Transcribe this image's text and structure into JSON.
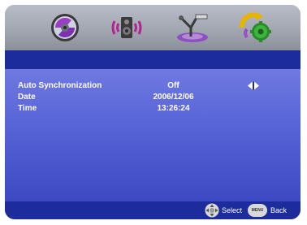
{
  "menu_icons": [
    {
      "name": "disc-setup-icon",
      "selected": false
    },
    {
      "name": "speaker-audio-icon",
      "selected": false
    },
    {
      "name": "satellite-dish-icon",
      "selected": false
    },
    {
      "name": "clock-settings-icon",
      "selected": true
    }
  ],
  "rows": [
    {
      "label": "Auto Synchronization",
      "value": "Off",
      "has_arrows": true
    },
    {
      "label": "Date",
      "value": "2006/12/06",
      "has_arrows": false
    },
    {
      "label": "Time",
      "value": "13:26:24",
      "has_arrows": false
    }
  ],
  "footer": {
    "select_label": "Select",
    "menu_button_label": "MENU",
    "back_label": "Back"
  },
  "colors": {
    "title_bar": "#1c2c9a",
    "content_bg": "#5663d6",
    "text": "#ffffff"
  }
}
